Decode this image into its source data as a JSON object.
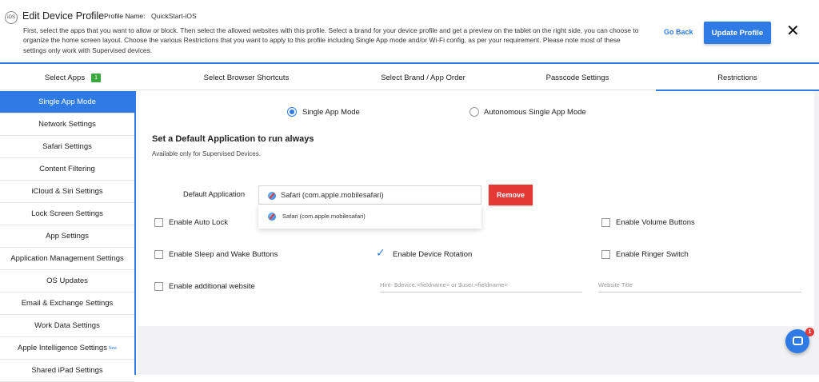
{
  "header": {
    "os_badge": "iOS",
    "title": "Edit Device Profile",
    "profile_label": "Profile Name:",
    "profile_name": "QuickStart-iOS",
    "description": "First, select the apps that you want to allow or block. Then select the allowed websites with this profile. Select a brand for your device profile and get a preview on the tablet on the right side, you can choose to organize the home screen layout. Choose the various Restrictions that you want to apply to this profile including Single App mode and/or Wi-Fi config, as per your requirement. Please note most of these settings only work with Supervised devices.",
    "go_back": "Go Back",
    "update": "Update Profile",
    "close": "✕"
  },
  "tabs": [
    {
      "label": "Select Apps",
      "count": "1"
    },
    {
      "label": "Select Browser Shortcuts"
    },
    {
      "label": "Select Brand / App Order"
    },
    {
      "label": "Passcode Settings"
    },
    {
      "label": "Restrictions",
      "active": true
    }
  ],
  "sidebar": {
    "items": [
      "Single App Mode",
      "Network Settings",
      "Safari Settings",
      "Content Filtering",
      "iCloud & Siri Settings",
      "Lock Screen Settings",
      "App Settings",
      "Application Management Settings",
      "OS Updates",
      "Email & Exchange Settings",
      "Work Data Settings",
      "Apple Intelligence Settings",
      "Shared iPad Settings"
    ],
    "new_tag": "New"
  },
  "mode": {
    "single": "Single App Mode",
    "autonomous": "Autonomous Single App Mode",
    "selected": "Single App Mode"
  },
  "section": {
    "title": "Set a Default Application to run always",
    "subtitle": "Available only for Supervised Devices."
  },
  "default_app": {
    "label": "Default Application",
    "value": "Safari (com.apple.mobilesafari)",
    "remove": "Remove",
    "option": "Safari (com.apple.mobilesafari)"
  },
  "options": {
    "auto_lock": "Enable Auto Lock",
    "volume_buttons": "Enable Volume Buttons",
    "sleep_wake": "Enable Sleep and Wake Buttons",
    "device_rotation": "Enable Device Rotation",
    "ringer_switch": "Enable Ringer Switch",
    "additional_website": "Enable additional website"
  },
  "inputs": {
    "hint_placeholder": "Hint- $device.<fieldname> or $user.<fieldname>",
    "title_placeholder": "Website Title"
  },
  "chat": {
    "badge": "1"
  },
  "colors": {
    "accent": "#2f7be5",
    "danger": "#e53935",
    "success": "#3aa83a"
  }
}
